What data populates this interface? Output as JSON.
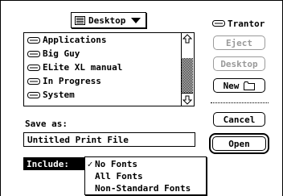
{
  "folder_popup": {
    "label": "Desktop",
    "icon": "desktop-icon"
  },
  "file_list": {
    "items": [
      {
        "label": "Applications",
        "icon": "drive-icon"
      },
      {
        "label": "Big Guy",
        "icon": "drive-icon"
      },
      {
        "label": "ELite XL manual",
        "icon": "drive-icon"
      },
      {
        "label": "In Progress",
        "icon": "drive-icon"
      },
      {
        "label": "System",
        "icon": "drive-icon"
      }
    ]
  },
  "drive": {
    "label": "Trantor",
    "icon": "drive-icon"
  },
  "buttons": {
    "eject": "Eject",
    "desktop": "Desktop",
    "new": "New",
    "cancel": "Cancel",
    "open": "Open"
  },
  "save_as": {
    "label": "Save as:",
    "value": "Untitled Print File"
  },
  "include": {
    "label": "Include:",
    "selected": "No Fonts",
    "options": [
      "No Fonts",
      "All Fonts",
      "Non-Standard Fonts"
    ],
    "check_mark": "✓"
  }
}
